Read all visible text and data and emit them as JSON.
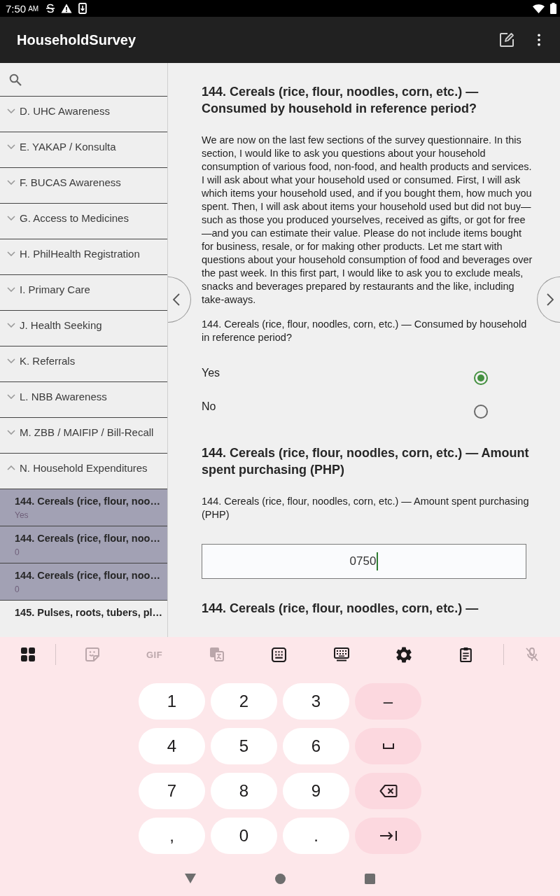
{
  "status_bar": {
    "time": "7:50",
    "meridiem": "AM"
  },
  "app_bar": {
    "title": "HouseholdSurvey"
  },
  "sidebar": {
    "sections": [
      {
        "label": "D. UHC Awareness",
        "expanded": false
      },
      {
        "label": "E. YAKAP / Konsulta",
        "expanded": false
      },
      {
        "label": "F. BUCAS Awareness",
        "expanded": false
      },
      {
        "label": "G. Access to Medicines",
        "expanded": false
      },
      {
        "label": "H. PhilHealth Registration",
        "expanded": false
      },
      {
        "label": "I. Primary Care",
        "expanded": false
      },
      {
        "label": "J. Health Seeking",
        "expanded": false
      },
      {
        "label": "K. Referrals",
        "expanded": false
      },
      {
        "label": "L. NBB Awareness",
        "expanded": false
      },
      {
        "label": "M. ZBB / MAIFIP / Bill-Recall",
        "expanded": false
      },
      {
        "label": "N. Household Expenditures",
        "expanded": true,
        "children": [
          {
            "title": "144. Cereals (rice, flour, noo…",
            "value": "Yes",
            "selected": true
          },
          {
            "title": "144. Cereals (rice, flour, noo…",
            "value": "0",
            "selected": true
          },
          {
            "title": "144. Cereals (rice, flour, noo…",
            "value": "0",
            "selected": true
          },
          {
            "title": "145. Pulses, roots, tubers, pl…",
            "selected": false
          }
        ]
      }
    ]
  },
  "questions": [
    {
      "kind": "choice",
      "heading": "144. Cereals (rice, flour, noodles, corn, etc.) — Consumed by household in reference period?",
      "intro": "We are now on the last few sections of the survey questionnaire. In this section, I would like to ask you questions about your household consumption of various food, non-food, and health products and services. I will ask about what your household used or consumed. First, I will ask which items your household used, and if you bought them, how much you spent. Then, I will ask about items your household used but did not buy—such as those you produced yourselves, received as gifts, or got for free—and you can estimate their value. Please do not include items bought for business, resale, or for making other products. Let me start with questions about your household consumption of food and beverages over the past week. In this first part, I would like to ask you to exclude meals, snacks and beverages prepared by restaurants and the like, including take-aways.",
      "label": "144. Cereals (rice, flour, noodles, corn, etc.) — Consumed by household in reference period?",
      "options": [
        {
          "label": "Yes",
          "selected": true
        },
        {
          "label": "No",
          "selected": false
        }
      ]
    },
    {
      "kind": "number",
      "heading": "144. Cereals (rice, flour, noodles, corn, etc.) — Amount spent purchasing (PHP)",
      "label": "144. Cereals (rice, flour, noodles, corn, etc.) — Amount spent purchasing (PHP)",
      "value": "0750"
    },
    {
      "kind": "heading",
      "heading": "144. Cereals (rice, flour, noodles, corn, etc.) —"
    }
  ],
  "keyboard": {
    "toolbar_groups": [
      {
        "items": [
          {
            "kind": "apps",
            "disabled": false
          }
        ]
      },
      {
        "items": [
          {
            "kind": "sticker",
            "disabled": true
          },
          {
            "kind": "gif",
            "label": "GIF",
            "disabled": true
          },
          {
            "kind": "translate",
            "disabled": true
          },
          {
            "kind": "numpad",
            "disabled": false
          },
          {
            "kind": "keyboard",
            "disabled": false
          },
          {
            "kind": "settings",
            "disabled": false
          },
          {
            "kind": "clipboard",
            "disabled": false
          }
        ]
      },
      {
        "items": [
          {
            "kind": "mic",
            "disabled": true
          }
        ]
      }
    ],
    "keys": [
      {
        "kind": "char",
        "label": "1"
      },
      {
        "kind": "char",
        "label": "2"
      },
      {
        "kind": "char",
        "label": "3"
      },
      {
        "kind": "symbol",
        "label": "–"
      },
      {
        "kind": "char",
        "label": "4"
      },
      {
        "kind": "char",
        "label": "5"
      },
      {
        "kind": "char",
        "label": "6"
      },
      {
        "kind": "space"
      },
      {
        "kind": "char",
        "label": "7"
      },
      {
        "kind": "char",
        "label": "8"
      },
      {
        "kind": "char",
        "label": "9"
      },
      {
        "kind": "backspace"
      },
      {
        "kind": "char",
        "label": ","
      },
      {
        "kind": "char",
        "label": "0"
      },
      {
        "kind": "char",
        "label": "."
      },
      {
        "kind": "tab"
      }
    ]
  }
}
